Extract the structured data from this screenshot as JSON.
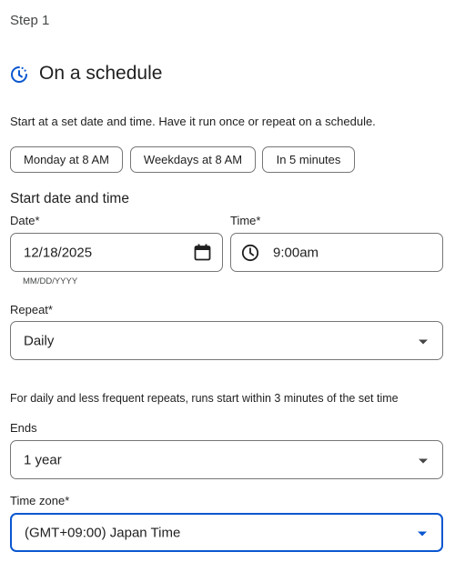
{
  "step_label": "Step 1",
  "header": {
    "title": "On a schedule",
    "icon": "schedule-icon"
  },
  "description": "Start at a set date and time. Have it run once or repeat on a schedule.",
  "quick_options": [
    "Monday at 8 AM",
    "Weekdays at 8 AM",
    "In 5 minutes"
  ],
  "start": {
    "heading": "Start date and time",
    "date_label": "Date*",
    "date_value": "12/18/2025",
    "date_hint": "MM/DD/YYYY",
    "time_label": "Time*",
    "time_value": "9:00am"
  },
  "repeat": {
    "label": "Repeat*",
    "value": "Daily"
  },
  "repeat_note": "For daily and less frequent repeats, runs start within 3 minutes of the set time",
  "ends": {
    "label": "Ends",
    "value": "1 year"
  },
  "timezone": {
    "label": "Time zone*",
    "value": "(GMT+09:00) Japan Time"
  },
  "colors": {
    "accent": "#0b57d0",
    "border": "#747775",
    "text": "#1f1f1f"
  }
}
